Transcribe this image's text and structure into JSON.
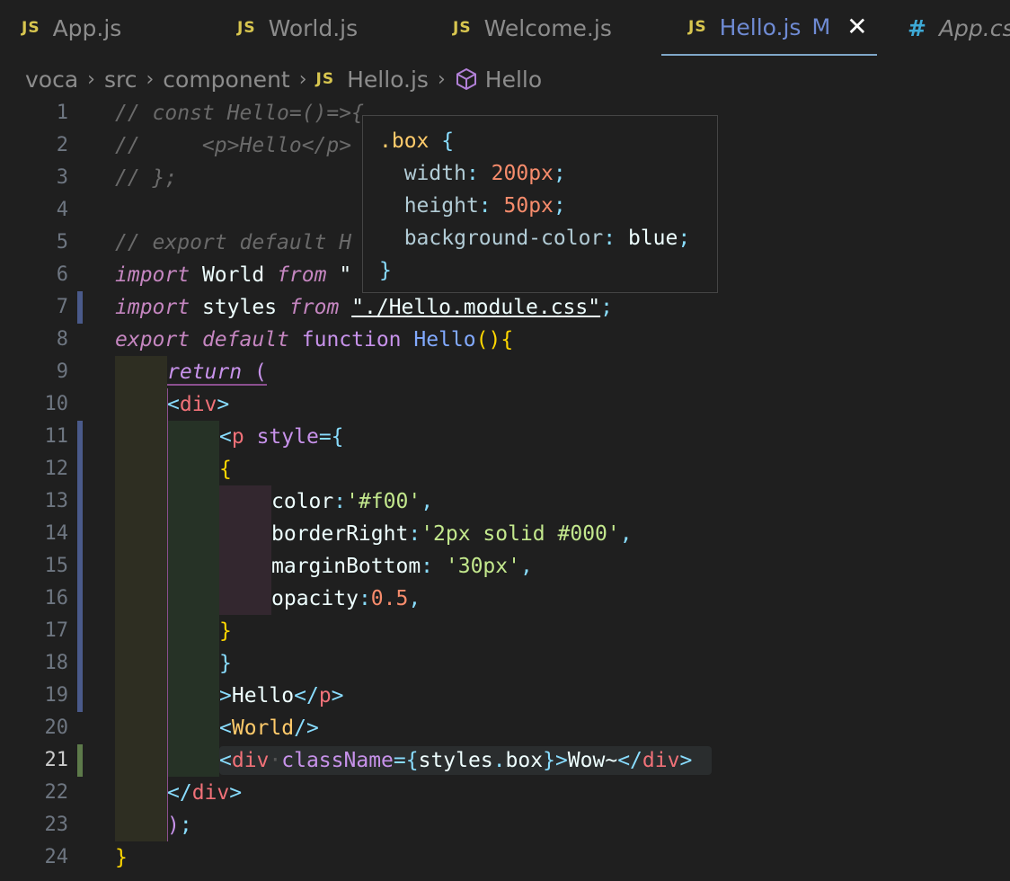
{
  "tabs": [
    {
      "label": "App.js",
      "badge": "JS"
    },
    {
      "label": "World.js",
      "badge": "JS"
    },
    {
      "label": "Welcome.js",
      "badge": "JS"
    },
    {
      "label": "Hello.js",
      "badge": "JS",
      "modified": "M",
      "close": "✕"
    },
    {
      "label": "App.cs",
      "badge": "#"
    }
  ],
  "breadcrumb": {
    "items": [
      "voca",
      "src",
      "component",
      "Hello.js",
      "Hello"
    ],
    "js_badge": "JS",
    "separator": "›"
  },
  "line_numbers": [
    "1",
    "2",
    "3",
    "4",
    "5",
    "6",
    "7",
    "8",
    "9",
    "10",
    "11",
    "12",
    "13",
    "14",
    "15",
    "16",
    "17",
    "18",
    "19",
    "20",
    "21",
    "22",
    "23",
    "24"
  ],
  "hover": {
    "selector": ".box",
    "open": "{",
    "props": [
      {
        "name": "width",
        "value": "200px"
      },
      {
        "name": "height",
        "value": "50px"
      },
      {
        "name": "background-color",
        "value": "blue"
      }
    ],
    "close": "}"
  },
  "code": {
    "l1": "// const Hello=()=>{",
    "l2": "//     <p>Hello</p>",
    "l3": "// };",
    "l5": "// export default H",
    "l6_kw": "import",
    "l6_id": "World",
    "l6_from": "from",
    "l6_rest": "\"",
    "l7_kw": "import",
    "l7_id": "styles",
    "l7_from": "from",
    "l7_str": "\"./Hello.module.css\"",
    "l7_semi": ";",
    "l8_export": "export",
    "l8_default": "default",
    "l8_function": "function",
    "l8_name": "Hello",
    "l9_return": "return",
    "l9_paren": "(",
    "l10": "div",
    "l11_tag": "p",
    "l11_attr": "style",
    "l13_prop": "color",
    "l13_val": "'#f00'",
    "l14_prop": "borderRight",
    "l14_val": "'2px solid #000'",
    "l15_prop": "marginBottom",
    "l15_val": "'30px'",
    "l16_prop": "opacity",
    "l16_val": "0.5",
    "l19_text": "Hello",
    "l19_tag": "p",
    "l20_comp": "World",
    "l21_tag": "div",
    "l21_attr": "className",
    "l21_expr": "styles",
    "l21_member": "box",
    "l21_text": "Wow~",
    "l22_tag": "div"
  }
}
